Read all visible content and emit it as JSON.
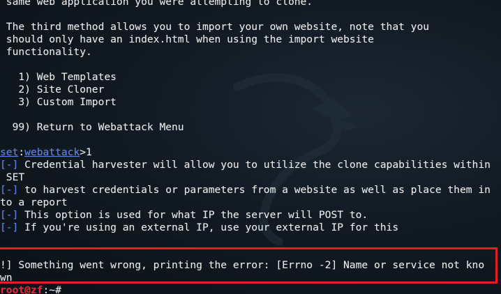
{
  "terminal": {
    "lines": [
      " same web application you were attempting to clone.",
      " The third method allows you to import your own website, note that you",
      " should only have an index.html when using the import website",
      " functionality.",
      "   1) Web Templates",
      "   2) Site Cloner",
      "   3) Custom Import",
      "  99) Return to Webattack Menu"
    ],
    "prompt": {
      "set": "set",
      "sep": ":",
      "module": "webattack",
      "gt": ">",
      "input": "1"
    },
    "info_marker": "[-]",
    "info_lines": [
      " Credential harvester will allow you to utilize the clone capabilities within",
      " SET",
      " to harvest credentials or parameters from a website as well as place them in",
      "to a report",
      " This option is used for what IP the server will POST to.",
      " If you're using an external IP, use your external IP for this"
    ],
    "error_lines": [
      "!] Something went wrong, printing the error: [Errno -2] Name or service not kno",
      "wn"
    ],
    "shell_prompt": {
      "user_host": "root@zf",
      "path": ":~#"
    }
  },
  "colors": {
    "background": "#0b1118",
    "text": "#ececec",
    "accent_blue": "#5c7fe6",
    "prompt_red": "#e7262f",
    "highlight_box": "#e31e26"
  }
}
